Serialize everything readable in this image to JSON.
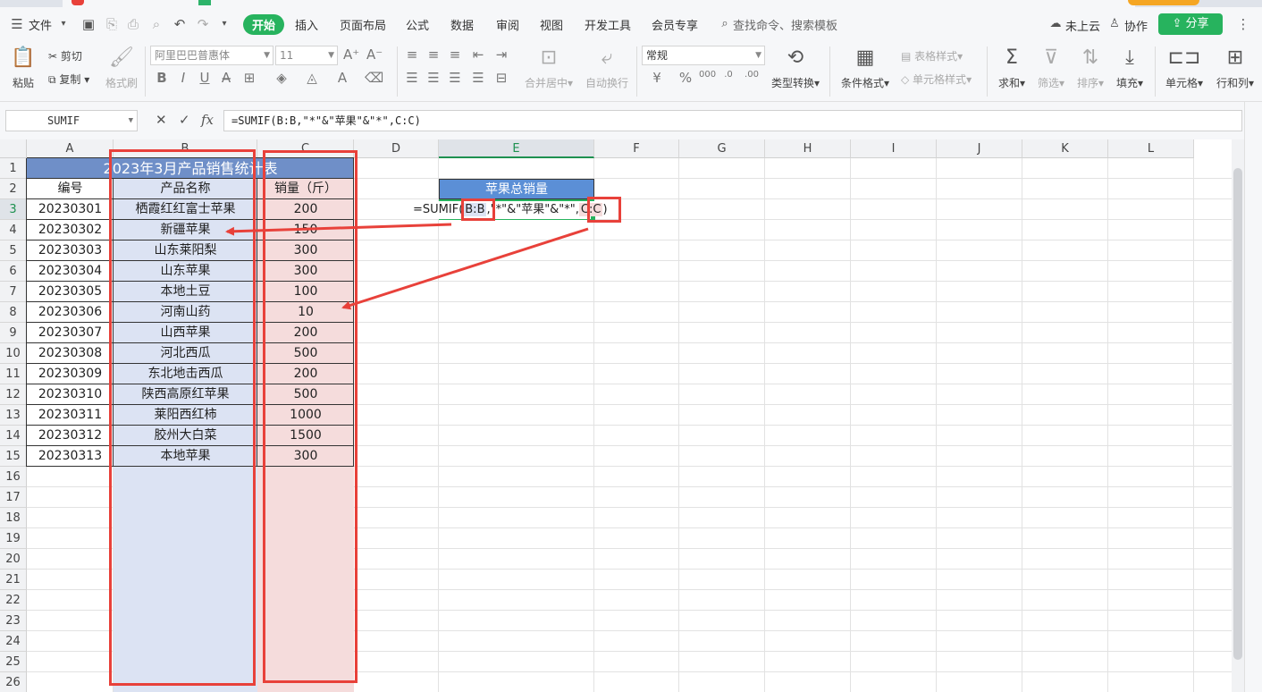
{
  "menu": {
    "file": "文件",
    "tabs": [
      "开始",
      "插入",
      "页面布局",
      "公式",
      "数据",
      "审阅",
      "视图",
      "开发工具",
      "会员专享"
    ],
    "search": "查找命令、搜索模板",
    "cloud": "未上云",
    "collab": "协作",
    "share": "分享"
  },
  "ribbon": {
    "paste": "粘贴",
    "cut": "剪切",
    "copy": "复制",
    "format_painter": "格式刷",
    "font_name": "阿里巴巴普惠体",
    "font_size": "11",
    "merge": "合并居中",
    "wrap": "自动换行",
    "number_format": "常规",
    "type_convert": "类型转换",
    "cond_format": "条件格式",
    "table_style": "表格样式",
    "cell_style": "单元格样式",
    "sum": "求和",
    "filter": "筛选",
    "sort": "排序",
    "fill": "填充",
    "cell": "单元格",
    "rowcol": "行和列"
  },
  "formula_bar": {
    "name_box": "SUMIF",
    "formula": "=SUMIF(B:B,\"*\"&\"苹果\"&\"*\",C:C)"
  },
  "grid": {
    "columns": [
      "A",
      "B",
      "C",
      "D",
      "E",
      "F",
      "G",
      "H",
      "I",
      "J",
      "K",
      "L"
    ],
    "rows": [
      "1",
      "2",
      "3",
      "4",
      "5",
      "6",
      "7",
      "8",
      "9",
      "10",
      "11",
      "12",
      "13",
      "14",
      "15",
      "16",
      "17",
      "18",
      "19",
      "20",
      "21",
      "22",
      "23",
      "24",
      "25",
      "26"
    ],
    "table_title": "2023年3月产品销售统计表",
    "headers": [
      "编号",
      "产品名称",
      "销量（斤）"
    ],
    "records": [
      [
        "20230301",
        "栖霞红红富士苹果",
        "200"
      ],
      [
        "20230302",
        "新疆苹果",
        "150"
      ],
      [
        "20230303",
        "山东莱阳梨",
        "300"
      ],
      [
        "20230304",
        "山东苹果",
        "300"
      ],
      [
        "20230305",
        "本地土豆",
        "100"
      ],
      [
        "20230306",
        "河南山药",
        "10"
      ],
      [
        "20230307",
        "山西苹果",
        "200"
      ],
      [
        "20230308",
        "河北西瓜",
        "500"
      ],
      [
        "20230309",
        "东北地击西瓜",
        "200"
      ],
      [
        "20230310",
        "陕西高原红苹果",
        "500"
      ],
      [
        "20230311",
        "莱阳西红柿",
        "1000"
      ],
      [
        "20230312",
        "胶州大白菜",
        "1500"
      ],
      [
        "20230313",
        "本地苹果",
        "300"
      ]
    ],
    "summary_label": "苹果总销量",
    "editing": {
      "prefix": "=SUMIF(",
      "ref1": "B:B",
      "middle": ",\"*\"&\"苹果\"&\"*\",",
      "ref2": "C:C",
      "suffix": ")"
    }
  },
  "colors": {
    "accent_green": "#27b35e",
    "title_fill": "#6f8fc8",
    "col_b_fill": "#dce3f3",
    "col_c_fill": "#f5dcdc",
    "header_blue": "#5b8fd6",
    "annotation_red": "#e8413a"
  }
}
